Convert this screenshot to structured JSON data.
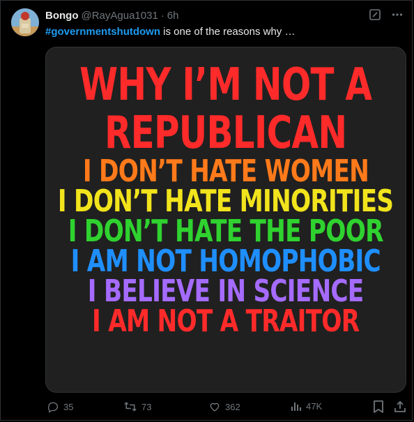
{
  "tweet": {
    "author_name": "Bongo",
    "handle": "@RayAgua1031",
    "separator": "·",
    "time": "6h",
    "hashtag": "#governmentshutdown",
    "text_rest": " is one of the reasons why …"
  },
  "media": {
    "lines": [
      {
        "text": "WHY I’M NOT A",
        "color": "#ff2a2a"
      },
      {
        "text": "REPUBLICAN",
        "color": "#ff2a2a"
      },
      {
        "text": "I DON’T HATE WOMEN",
        "color": "#ff7a1a"
      },
      {
        "text": "I DON’T HATE MINORITIES",
        "color": "#f2e41c"
      },
      {
        "text": "I DON’T HATE THE POOR",
        "color": "#2fd22f"
      },
      {
        "text": "I AM NOT HOMOPHOBIC",
        "color": "#1f8fff"
      },
      {
        "text": "I BELIEVE IN SCIENCE",
        "color": "#a56bff"
      },
      {
        "text": "I AM NOT A TRAITOR",
        "color": "#ff2a2a"
      }
    ]
  },
  "actions": {
    "replies": "35",
    "reposts": "73",
    "likes": "362",
    "views": "47K"
  },
  "icons": {
    "edit": "grok-icon",
    "more": "more-icon",
    "reply": "reply-icon",
    "repost": "repost-icon",
    "like": "like-icon",
    "views": "views-icon",
    "bookmark": "bookmark-icon",
    "share": "share-icon"
  },
  "colors": {
    "background": "#000000",
    "text": "#e7e9ea",
    "muted": "#71767b",
    "accent": "#1d9bf0",
    "media_bg": "#202020"
  }
}
